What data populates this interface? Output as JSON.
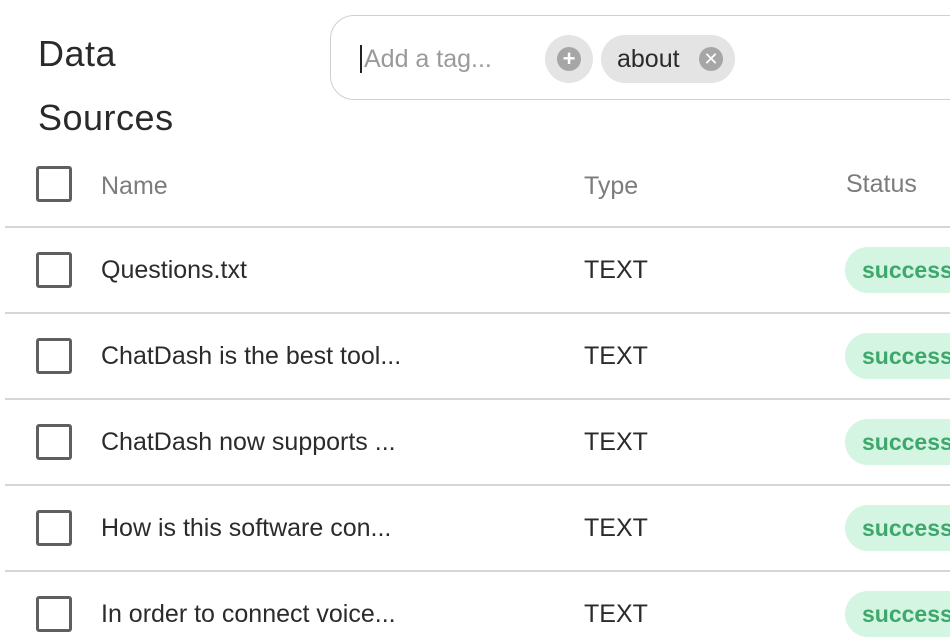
{
  "page": {
    "title_line1": "Data",
    "title_line2": "Sources"
  },
  "tag_input": {
    "placeholder": "Add a tag...",
    "value": "",
    "add_icon": "plus-circle-icon",
    "tags": [
      {
        "label": "about",
        "remove_icon": "close-circle-icon"
      }
    ]
  },
  "table": {
    "headers": {
      "name": "Name",
      "type": "Type",
      "status": "Status"
    },
    "rows": [
      {
        "name": "Questions.txt",
        "type": "TEXT",
        "status": "success"
      },
      {
        "name": "ChatDash is the best tool...",
        "type": "TEXT",
        "status": "success"
      },
      {
        "name": "ChatDash now supports ...",
        "type": "TEXT",
        "status": "success"
      },
      {
        "name": "How is this software con...",
        "type": "TEXT",
        "status": "success"
      },
      {
        "name": "In order to connect voice...",
        "type": "TEXT",
        "status": "success"
      }
    ]
  },
  "colors": {
    "badge_bg": "#d4f5e2",
    "badge_text": "#3ea86c",
    "chip_bg": "#e4e4e4"
  }
}
